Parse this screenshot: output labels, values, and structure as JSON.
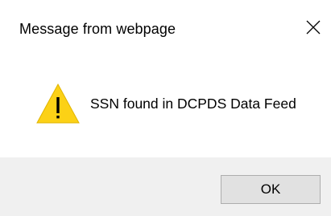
{
  "dialog": {
    "title": "Message from webpage",
    "message": "SSN found in DCPDS Data Feed",
    "icon": "warning-icon",
    "buttons": {
      "ok_label": "OK"
    }
  },
  "colors": {
    "background": "#ffffff",
    "footer": "#f0f0f0",
    "button": "#e1e1e1",
    "button_border": "#adadad",
    "warning_fill": "#fcd116"
  }
}
